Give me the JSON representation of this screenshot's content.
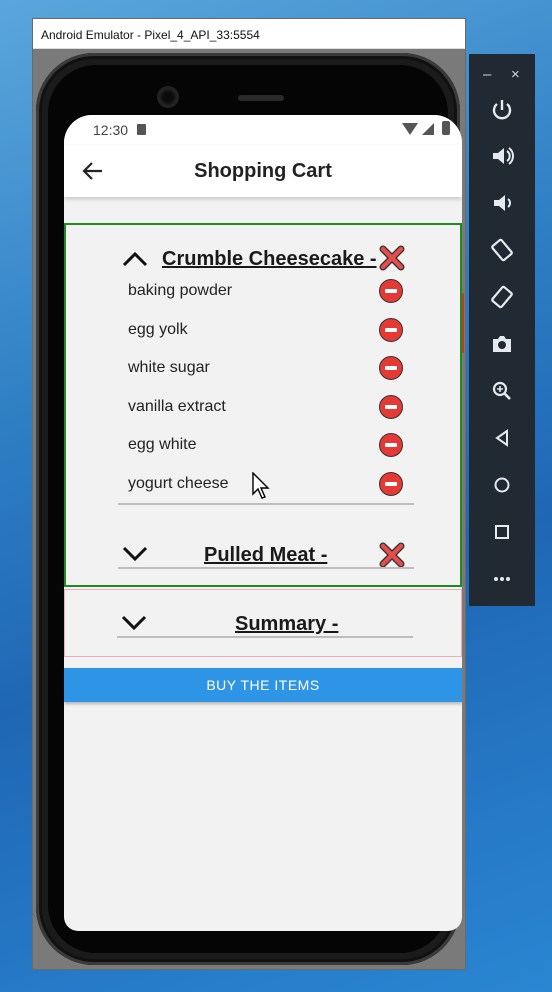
{
  "window": {
    "title": "Android Emulator - Pixel_4_API_33:5554"
  },
  "status_bar": {
    "time": "12:30"
  },
  "app_bar": {
    "title": "Shopping Cart"
  },
  "cart": {
    "recipes": [
      {
        "title": "Crumble Cheesecake -",
        "expanded": true,
        "items": [
          "baking powder",
          "egg yolk",
          "white sugar",
          "vanilla extract",
          "egg white",
          "yogurt cheese"
        ]
      },
      {
        "title": "Pulled Meat -",
        "expanded": false
      }
    ]
  },
  "summary": {
    "title": "Summary -",
    "expanded": false
  },
  "buy_button": {
    "label": "BUY THE ITEMS"
  },
  "toolbar": {
    "top_buttons": [
      "–",
      "×"
    ],
    "buttons": [
      "power-icon",
      "volume-up-icon",
      "volume-down-icon",
      "rotate-left-icon",
      "rotate-right-icon",
      "camera-icon",
      "zoom-icon",
      "back-icon",
      "home-icon",
      "overview-icon",
      "more-icon"
    ]
  },
  "colors": {
    "cart_border": "#1f8a1f",
    "summary_border": "#f1a9b8",
    "buy_button": "#2e95e6",
    "remove_icon": "#e53935",
    "toolbar_bg": "#212a33"
  }
}
